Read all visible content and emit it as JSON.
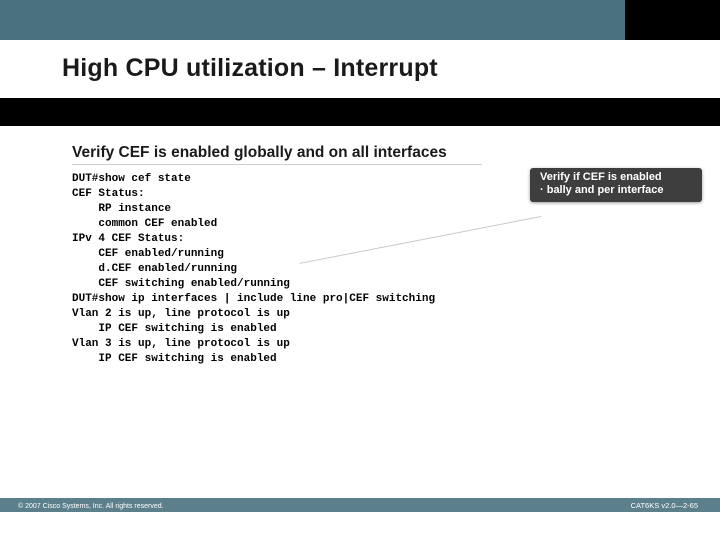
{
  "title": "High CPU utilization – Interrupt",
  "section_heading": "Verify CEF is enabled globally and on all interfaces",
  "cli_output": "DUT#show cef state\nCEF Status:\n    RP instance\n    common CEF enabled\nIPv 4 CEF Status:\n    CEF enabled/running\n    d.CEF enabled/running\n    CEF switching enabled/running\nDUT#show ip interfaces | include line pro|CEF switching\nVlan 2 is up, line protocol is up\n    IP CEF switching is enabled\nVlan 3 is up, line protocol is up\n    IP CEF switching is enabled",
  "callout_line1": "Verify if CEF is enabled",
  "callout_line2": "· bally and per interface",
  "footer_left": "© 2007 Cisco Systems, Inc. All rights reserved.",
  "footer_right": "CAT6KS v2.0—2-65"
}
